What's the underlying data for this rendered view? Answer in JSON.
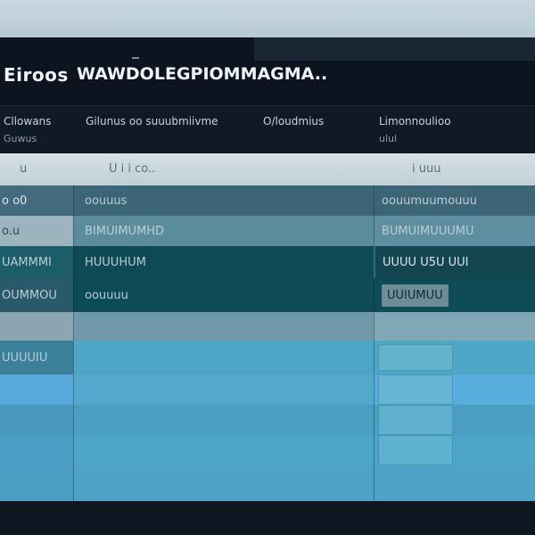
{
  "window": {
    "app_name": "Eiroos",
    "title": "WAWDOLEGPIOMMAGMA.."
  },
  "toolbar": {
    "item1": "Cllowans",
    "item1_sub": "Guwus",
    "item2": "Gilunus oo suuubmiivme",
    "item3": "O/loudmius",
    "item4": "Limonnoulioo",
    "item4_sub": "ulul"
  },
  "table": {
    "headers": [
      "u",
      "U i i co..",
      "i uuu"
    ],
    "rows": [
      [
        "o o0",
        "oouuus",
        "oouumuumouuu"
      ],
      [
        "o.u",
        "BIMUIMUMHD",
        "BUMUIMUUUMU"
      ],
      [
        "UAMMMI",
        "HUUUHUM",
        "UUUU U5U UUI"
      ],
      [
        "OUMMOU",
        "oouuuu",
        "UUIUMUU"
      ],
      [
        "",
        "",
        ""
      ],
      [
        "UUUUIU",
        "",
        ""
      ],
      [
        "",
        "",
        ""
      ],
      [
        "",
        "",
        ""
      ],
      [
        "",
        "",
        ""
      ],
      [
        "",
        "",
        ""
      ]
    ]
  }
}
